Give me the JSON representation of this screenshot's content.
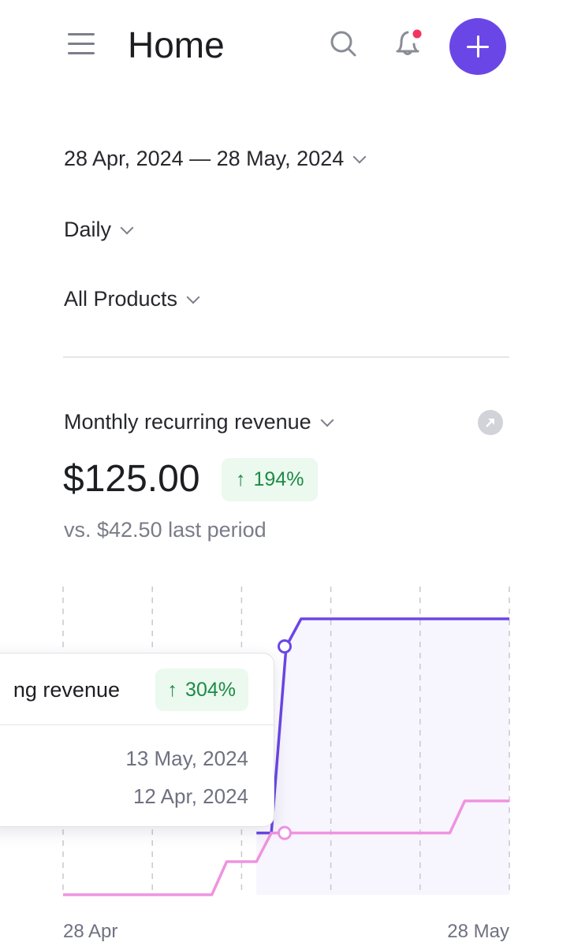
{
  "header": {
    "title": "Home",
    "icons": [
      "menu-icon",
      "search-icon",
      "bell-icon",
      "plus-icon"
    ],
    "notification_dot_color": "#f0365f",
    "accent": "#6b46e6"
  },
  "filters": {
    "date_range": "28 Apr, 2024 — 28 May, 2024",
    "interval": "Daily",
    "products": "All Products"
  },
  "metric": {
    "title": "Monthly recurring revenue",
    "value": "$125.00",
    "change": "194%",
    "comparison": "vs. $42.50 last period"
  },
  "tooltip": {
    "label": "ng revenue",
    "change": "304%",
    "current_date": "13 May, 2024",
    "previous_date": "12 Apr, 2024"
  },
  "chart_data": {
    "type": "line",
    "x_tick_labels": [
      "28 Apr",
      "28 May"
    ],
    "x_range_days": [
      0,
      30
    ],
    "ylim": [
      0,
      130
    ],
    "grid": "vertical dashed",
    "highlight_day": 15,
    "series": [
      {
        "role": "current",
        "color": "#6b46e6",
        "points": [
          [
            13,
            28
          ],
          [
            14,
            28
          ],
          [
            15,
            112.5
          ],
          [
            16,
            125
          ],
          [
            30,
            125
          ]
        ]
      },
      {
        "role": "previous",
        "color": "#ef93e0",
        "points": [
          [
            0,
            0
          ],
          [
            10,
            0
          ],
          [
            11,
            15
          ],
          [
            13,
            15
          ],
          [
            14,
            28
          ],
          [
            26,
            28
          ],
          [
            27,
            42.5
          ],
          [
            30,
            42.5
          ]
        ]
      }
    ]
  }
}
